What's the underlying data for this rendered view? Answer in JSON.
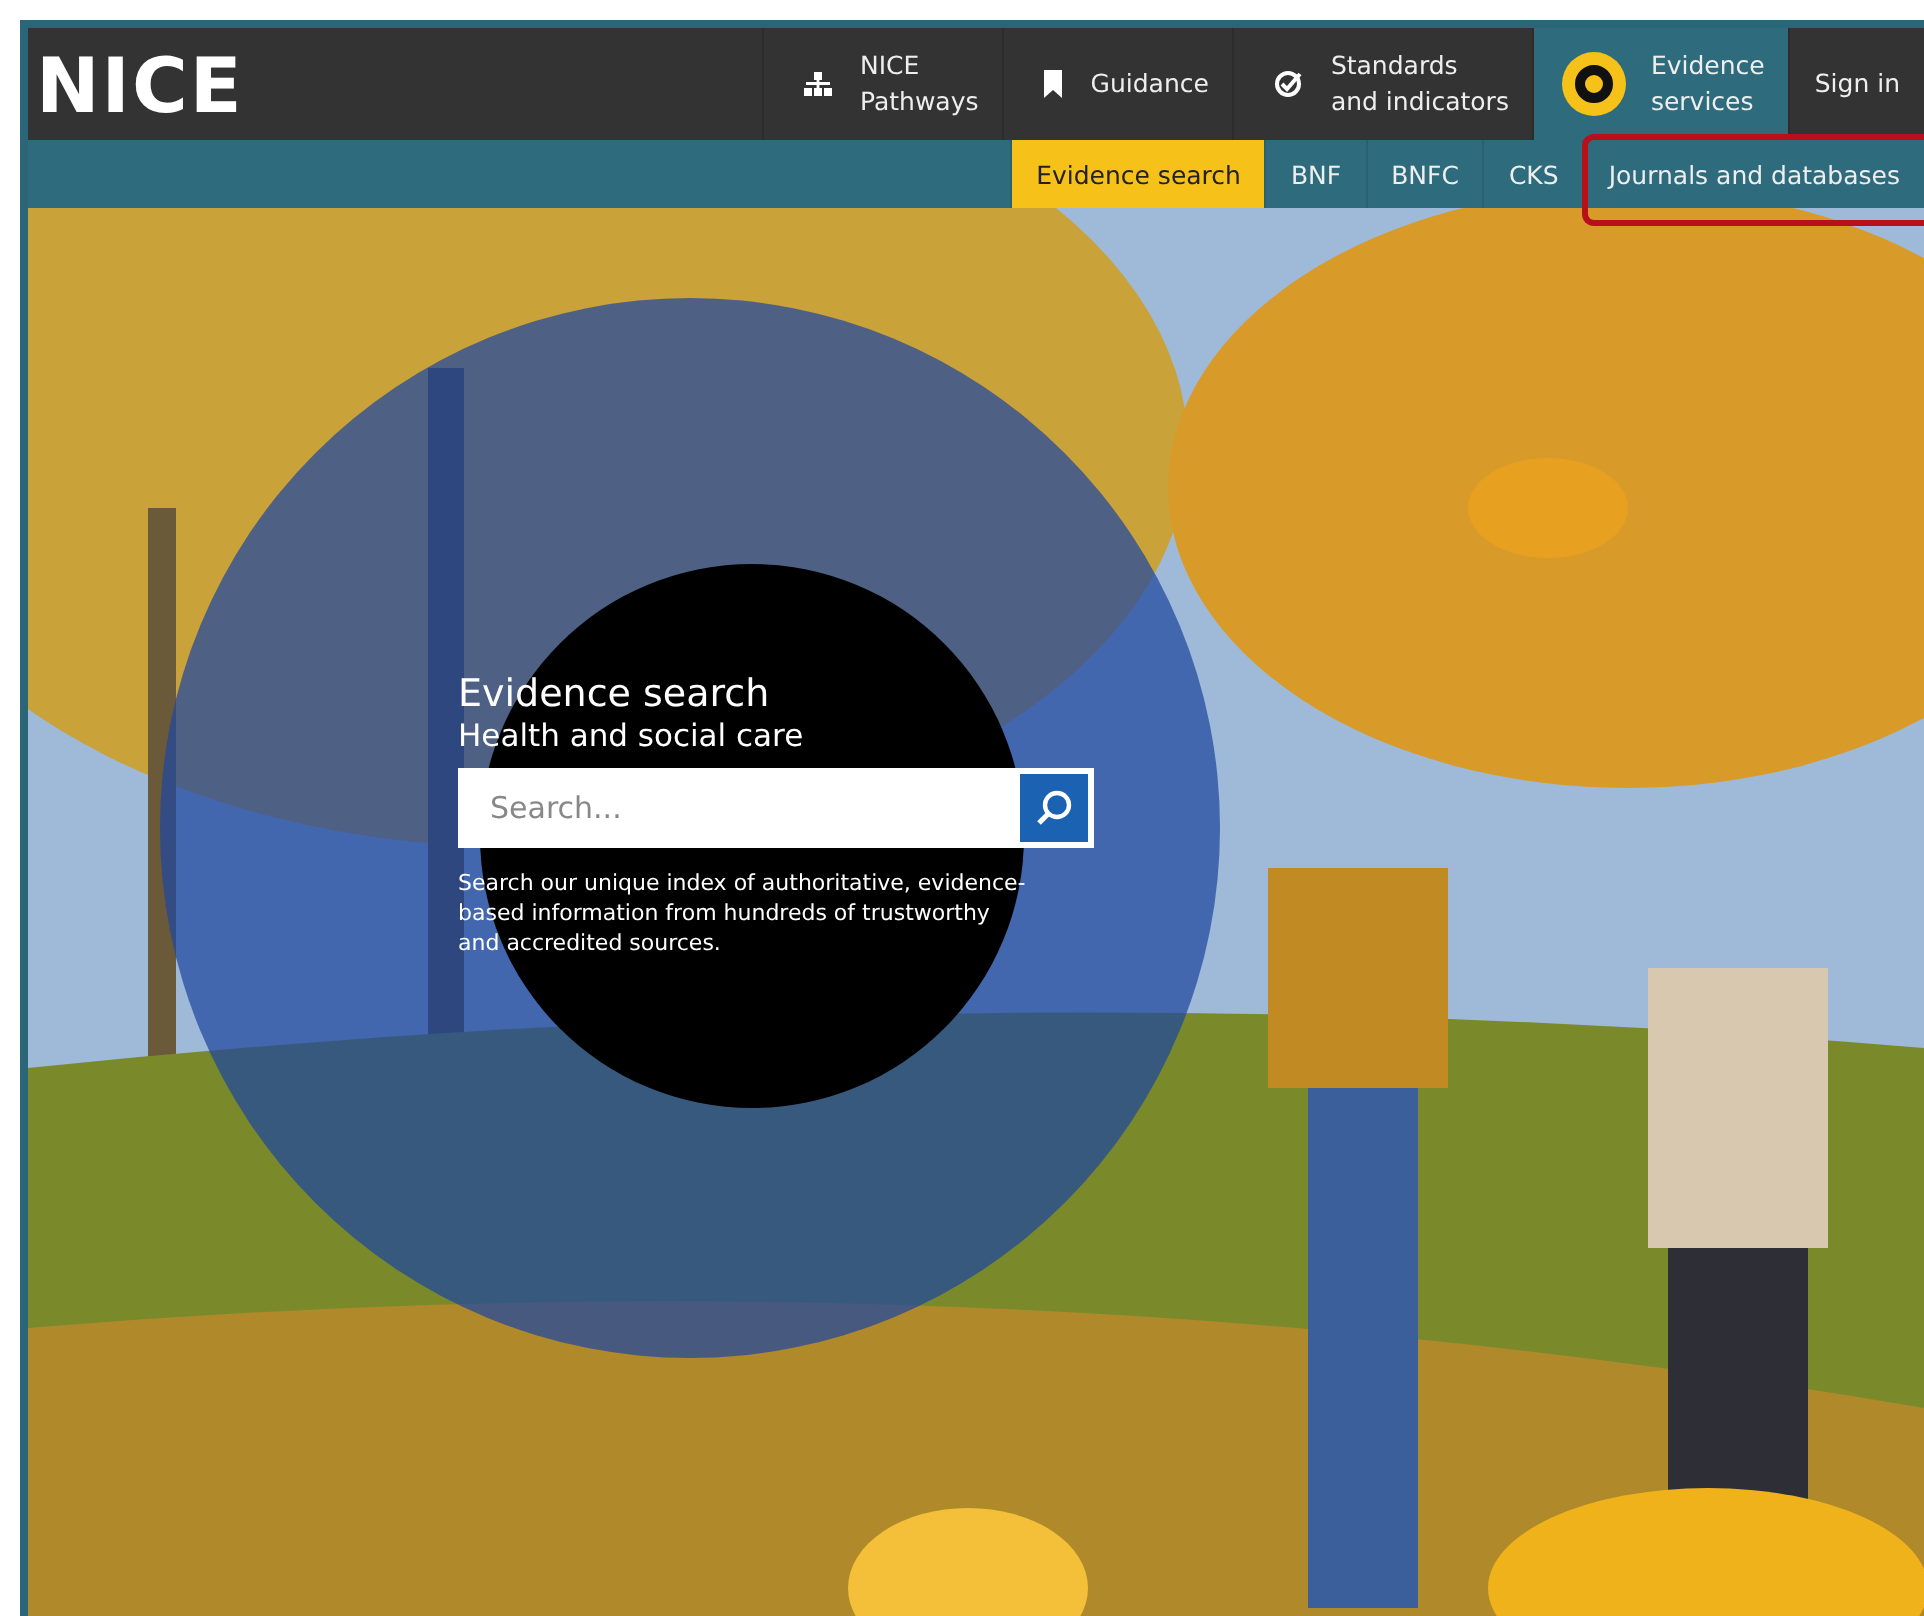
{
  "header": {
    "logo": "NICE",
    "nav": [
      {
        "lines": [
          "NICE",
          "Pathways"
        ],
        "selected": false
      },
      {
        "lines": [
          "Guidance"
        ],
        "selected": false
      },
      {
        "lines": [
          "Standards",
          "and indicators"
        ],
        "selected": false
      },
      {
        "lines": [
          "Evidence",
          "services"
        ],
        "selected": true
      },
      {
        "lines": [
          "Sign in"
        ],
        "selected": false
      }
    ]
  },
  "subnav": [
    {
      "label": "Evidence search",
      "selected": true,
      "highlighted": false
    },
    {
      "label": "BNF",
      "selected": false,
      "highlighted": false
    },
    {
      "label": "BNFC",
      "selected": false,
      "highlighted": false
    },
    {
      "label": "CKS",
      "selected": false,
      "highlighted": false
    },
    {
      "label": "Journals and databases",
      "selected": false,
      "highlighted": true
    }
  ],
  "hero": {
    "title": "Evidence search",
    "subtitle": "Health and social care",
    "search": {
      "placeholder": "Search..."
    },
    "description": "Search our unique index of authoritative, evidence-based information from hundreds of trustworthy and accredited sources."
  }
}
